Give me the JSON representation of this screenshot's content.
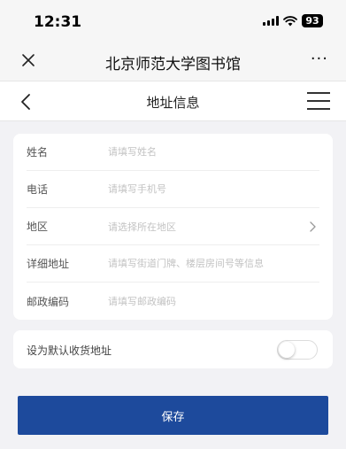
{
  "status": {
    "time": "12:31",
    "battery": "93"
  },
  "browser": {
    "title": "北京师范大学图书馆",
    "more": "···"
  },
  "page": {
    "title": "地址信息"
  },
  "form": {
    "name": {
      "label": "姓名",
      "placeholder": "请填写姓名"
    },
    "phone": {
      "label": "电话",
      "placeholder": "请填写手机号"
    },
    "region": {
      "label": "地区",
      "placeholder": "请选择所在地区"
    },
    "detail": {
      "label": "详细地址",
      "placeholder": "请填写街道门牌、楼层房间号等信息"
    },
    "postal": {
      "label": "邮政编码",
      "placeholder": "请填写邮政编码"
    }
  },
  "default_address": {
    "label": "设为默认收货地址",
    "enabled": false
  },
  "save_label": "保存",
  "colors": {
    "accent": "#1d4a9c",
    "background": "#f2f2f5"
  }
}
